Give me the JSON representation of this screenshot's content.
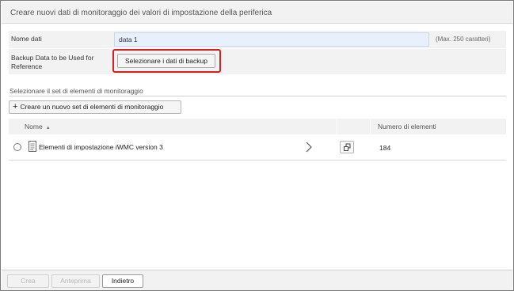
{
  "dialog": {
    "title": "Creare nuovi dati di monitoraggio dei valori di impostazione della periferica"
  },
  "form": {
    "name_label": "Nome dati",
    "name_value": "data 1",
    "name_hint": "(Max. 250 caratteri)",
    "backup_label": "Backup Data to be Used for Reference",
    "backup_button": "Selezionare i dati di backup"
  },
  "monitor_set": {
    "section_label": "Selezionare il set di elementi di monitoraggio",
    "create_button": "Creare un nuovo set di elementi di monitoraggio",
    "columns": {
      "name": "Nome",
      "count": "Numero di elementi"
    },
    "rows": [
      {
        "name": "Elementi di impostazione iWMC version 3",
        "count": "184",
        "selected": false
      }
    ]
  },
  "footer": {
    "create_label": "Crea",
    "preview_label": "Anteprima",
    "back_label": "Indietro"
  },
  "colors": {
    "highlight": "#d42020",
    "input_bg": "#e8f0fc",
    "panel_bg": "#f2f2f2"
  },
  "icons": {
    "sort": "sort-ascending-icon",
    "row_doc": "document-icon",
    "row_open": "chevron-right-icon",
    "row_copy": "copy-icon",
    "create": "plus-icon"
  }
}
